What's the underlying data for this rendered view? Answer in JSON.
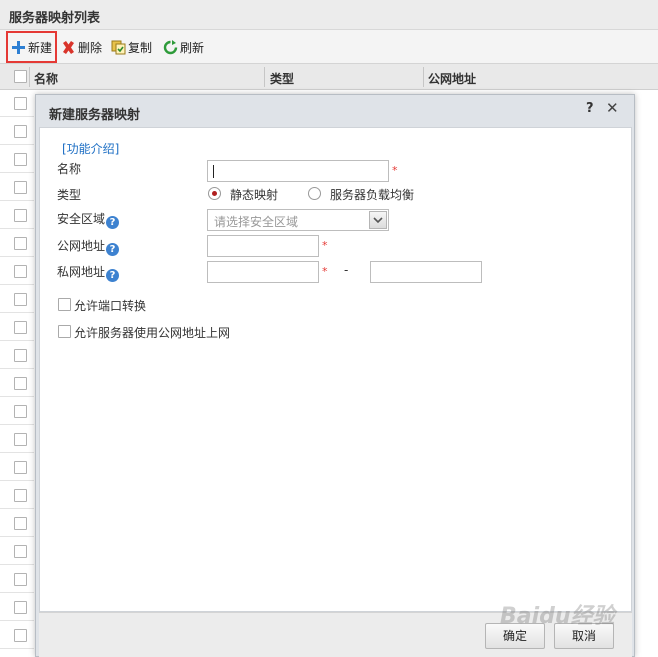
{
  "panel": {
    "title": "服务器映射列表"
  },
  "toolbar": {
    "new_label": "新建",
    "delete_label": "删除",
    "copy_label": "复制",
    "refresh_label": "刷新"
  },
  "grid": {
    "columns": [
      "名称",
      "类型",
      "公网地址"
    ]
  },
  "dialog": {
    "title": "新建服务器映射",
    "help": "?",
    "close": "✕",
    "intro_link": "[功能介绍]",
    "fields": {
      "name_label": "名称",
      "name_value": "",
      "type_label": "类型",
      "type_option_static": "静态映射",
      "type_option_lb": "服务器负载均衡",
      "type_selected": "静态映射",
      "zone_label": "安全区域",
      "zone_placeholder": "请选择安全区域",
      "public_label": "公网地址",
      "public_value": "",
      "private_label": "私网地址",
      "private_from": "",
      "private_to": "",
      "range_sep": "-",
      "required_mark": "*"
    },
    "options": {
      "port_translate": "允许端口转换",
      "allow_public_access": "允许服务器使用公网地址上网"
    },
    "buttons": {
      "ok": "确定",
      "cancel": "取消"
    }
  },
  "watermark": "Baidu经验",
  "colors": {
    "highlight_border": "#e53935",
    "link": "#1e6fc4",
    "required": "#e53935",
    "radio_dot": "#b01f1f"
  }
}
